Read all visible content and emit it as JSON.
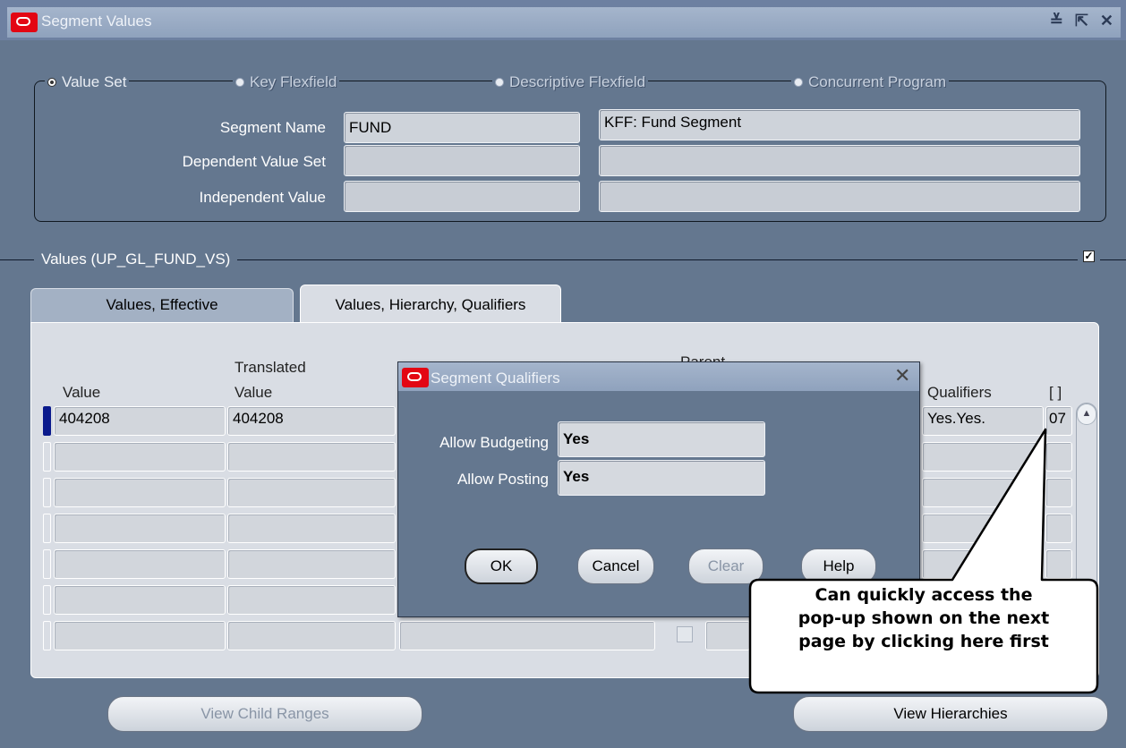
{
  "window": {
    "title": "Segment Values",
    "controls": "≚ ⇱ ✕"
  },
  "header": {
    "radios": [
      {
        "label": "Value Set",
        "selected": true,
        "enabled": true
      },
      {
        "label": "Key Flexfield",
        "selected": false,
        "enabled": false
      },
      {
        "label": "Descriptive Flexfield",
        "selected": false,
        "enabled": false
      },
      {
        "label": "Concurrent Program",
        "selected": false,
        "enabled": false
      }
    ],
    "segment_name_label": "Segment Name",
    "segment_name_value": "FUND",
    "segment_desc_value": "KFF: Fund Segment",
    "dependent_value_set_label": "Dependent Value Set",
    "independent_value_label": "Independent Value"
  },
  "values_section": {
    "title": "Values (UP_GL_FUND_VS)",
    "checkbox_checked": "✓"
  },
  "tabs": [
    {
      "label": "Values, Effective",
      "active": false
    },
    {
      "label": "Values, Hierarchy, Qualifiers",
      "active": true
    }
  ],
  "table": {
    "headers": {
      "value": "Value",
      "translated_1": "Translated",
      "translated_2": "Value",
      "parent": "Parent",
      "qualifiers": "Qualifiers",
      "bracket": "[ ]"
    },
    "rows": [
      {
        "value": "404208",
        "translated": "404208",
        "qualifiers": "Yes.Yes.",
        "extra": "07"
      }
    ]
  },
  "buttons": {
    "view_child_ranges": "View Child Ranges",
    "view_hierarchies": "View Hierarchies"
  },
  "dialog": {
    "title": "Segment Qualifiers",
    "allow_budgeting_label": "Allow Budgeting",
    "allow_budgeting_value": "Yes",
    "allow_posting_label": "Allow Posting",
    "allow_posting_value": "Yes",
    "ok": "OK",
    "cancel": "Cancel",
    "clear": "Clear",
    "help": "Help"
  },
  "callout": {
    "line1": "Can quickly access the",
    "line2": "pop-up shown on the next",
    "line3": "page by clicking here first"
  },
  "colors": {
    "background": "#64778f",
    "oracle_red": "#e30613",
    "current_row": "#0a1a8c"
  }
}
